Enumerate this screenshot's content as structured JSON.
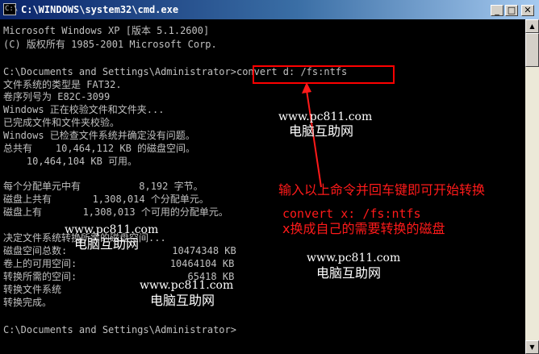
{
  "window": {
    "title": "C:\\WINDOWS\\system32\\cmd.exe",
    "icon": "cmd-icon",
    "controls": {
      "minimize": "_",
      "maximize": "□",
      "close": "✕"
    }
  },
  "console": {
    "lines": [
      "Microsoft Windows XP [版本 5.1.2600]",
      "(C) 版权所有 1985-2001 Microsoft Corp.",
      "",
      "C:\\Documents and Settings\\Administrator>convert d: /fs:ntfs",
      "文件系统的类型是 FAT32.",
      "卷序列号为 E82C-3099",
      "Windows 正在校验文件和文件夹...",
      "已完成文件和文件夹校验。",
      "Windows 已检查文件系统并确定没有问题。",
      "总共有    10,464,112 KB 的磁盘空间。",
      "    10,464,104 KB 可用。",
      "",
      "每个分配单元中有          8,192 字节。",
      "磁盘上共有       1,308,014 个分配单元。",
      "磁盘上有       1,308,013 个可用的分配单元。",
      "",
      "决定文件系统转换所需的磁盘空间...",
      "磁盘空间总数:                  10474348 KB",
      "卷上的可用空间:                10464104 KB",
      "转换所需的空间:                   65418 KB",
      "转换文件系统",
      "转换完成。",
      "",
      "C:\\Documents and Settings\\Administrator>"
    ]
  },
  "annotations": {
    "instruction": "输入以上命令并回车键即可开始转换",
    "command": "convert x: /fs:ntfs",
    "note": "x换成自己的需要转换的磁盘",
    "highlight_color": "#ff0000"
  },
  "watermarks": [
    {
      "url": "www.pc811.com",
      "name": "电脑互助网"
    },
    {
      "url": "www.pc811.com",
      "name": "电脑互助网"
    },
    {
      "url": "www.pc811.com",
      "name": "电脑互助网"
    },
    {
      "url": "www.pc811.com",
      "name": "电脑互助网"
    }
  ],
  "colors": {
    "console_bg": "#000000",
    "console_text": "#c0c0c0",
    "title_bar": "#0a246a",
    "annotation": "#ff1a1a"
  }
}
